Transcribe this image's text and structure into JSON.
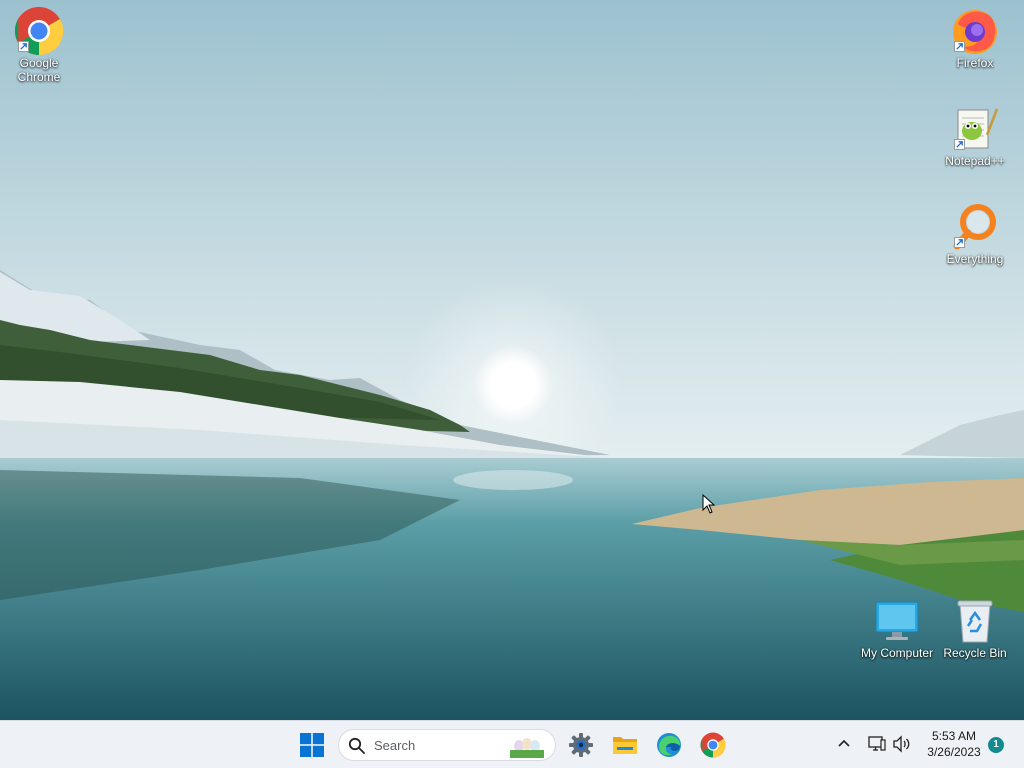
{
  "desktop": {
    "icons": [
      {
        "label": "Google Chrome",
        "icon": "chrome-icon"
      },
      {
        "label": "Firefox",
        "icon": "firefox-icon"
      },
      {
        "label": "Notepad++",
        "icon": "notepad-plus-plus-icon"
      },
      {
        "label": "Everything",
        "icon": "everything-search-icon"
      },
      {
        "label": "My Computer",
        "icon": "monitor-icon"
      },
      {
        "label": "Recycle Bin",
        "icon": "recycle-bin-icon"
      }
    ]
  },
  "taskbar": {
    "search": {
      "label": "Search"
    },
    "pinned": [
      "start-icon",
      "settings-icon",
      "file-explorer-icon",
      "edge-icon",
      "chrome-icon"
    ],
    "tray": {
      "time": "5:53 AM",
      "date": "3/26/2023",
      "notification_count": "1"
    }
  },
  "colors": {
    "taskbar_bg": "#eef1f5",
    "accent": "#0078d4",
    "notification_badge": "#138b8f"
  }
}
